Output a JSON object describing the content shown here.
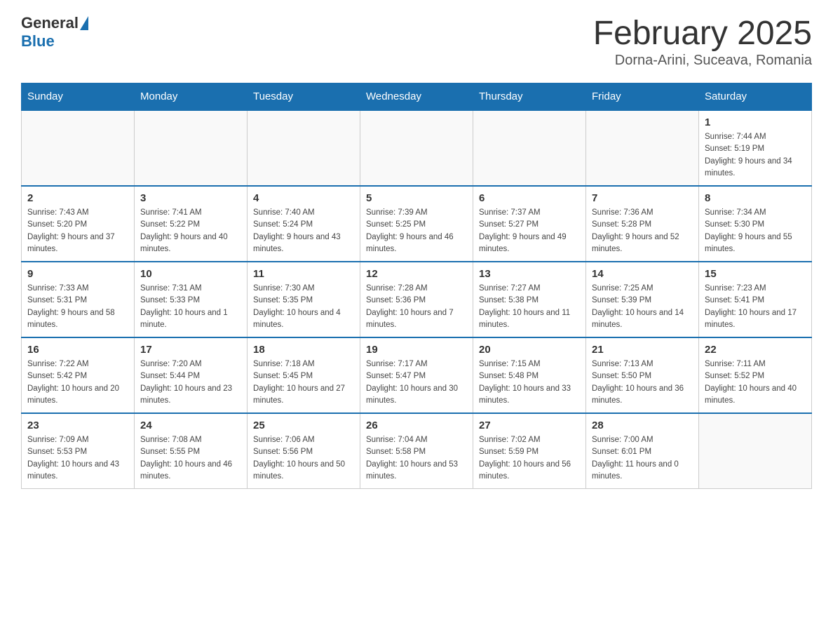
{
  "logo": {
    "general_text": "General",
    "blue_text": "Blue"
  },
  "title": {
    "month_year": "February 2025",
    "location": "Dorna-Arini, Suceava, Romania"
  },
  "weekdays": [
    "Sunday",
    "Monday",
    "Tuesday",
    "Wednesday",
    "Thursday",
    "Friday",
    "Saturday"
  ],
  "weeks": [
    [
      {
        "day": "",
        "info": ""
      },
      {
        "day": "",
        "info": ""
      },
      {
        "day": "",
        "info": ""
      },
      {
        "day": "",
        "info": ""
      },
      {
        "day": "",
        "info": ""
      },
      {
        "day": "",
        "info": ""
      },
      {
        "day": "1",
        "info": "Sunrise: 7:44 AM\nSunset: 5:19 PM\nDaylight: 9 hours and 34 minutes."
      }
    ],
    [
      {
        "day": "2",
        "info": "Sunrise: 7:43 AM\nSunset: 5:20 PM\nDaylight: 9 hours and 37 minutes."
      },
      {
        "day": "3",
        "info": "Sunrise: 7:41 AM\nSunset: 5:22 PM\nDaylight: 9 hours and 40 minutes."
      },
      {
        "day": "4",
        "info": "Sunrise: 7:40 AM\nSunset: 5:24 PM\nDaylight: 9 hours and 43 minutes."
      },
      {
        "day": "5",
        "info": "Sunrise: 7:39 AM\nSunset: 5:25 PM\nDaylight: 9 hours and 46 minutes."
      },
      {
        "day": "6",
        "info": "Sunrise: 7:37 AM\nSunset: 5:27 PM\nDaylight: 9 hours and 49 minutes."
      },
      {
        "day": "7",
        "info": "Sunrise: 7:36 AM\nSunset: 5:28 PM\nDaylight: 9 hours and 52 minutes."
      },
      {
        "day": "8",
        "info": "Sunrise: 7:34 AM\nSunset: 5:30 PM\nDaylight: 9 hours and 55 minutes."
      }
    ],
    [
      {
        "day": "9",
        "info": "Sunrise: 7:33 AM\nSunset: 5:31 PM\nDaylight: 9 hours and 58 minutes."
      },
      {
        "day": "10",
        "info": "Sunrise: 7:31 AM\nSunset: 5:33 PM\nDaylight: 10 hours and 1 minute."
      },
      {
        "day": "11",
        "info": "Sunrise: 7:30 AM\nSunset: 5:35 PM\nDaylight: 10 hours and 4 minutes."
      },
      {
        "day": "12",
        "info": "Sunrise: 7:28 AM\nSunset: 5:36 PM\nDaylight: 10 hours and 7 minutes."
      },
      {
        "day": "13",
        "info": "Sunrise: 7:27 AM\nSunset: 5:38 PM\nDaylight: 10 hours and 11 minutes."
      },
      {
        "day": "14",
        "info": "Sunrise: 7:25 AM\nSunset: 5:39 PM\nDaylight: 10 hours and 14 minutes."
      },
      {
        "day": "15",
        "info": "Sunrise: 7:23 AM\nSunset: 5:41 PM\nDaylight: 10 hours and 17 minutes."
      }
    ],
    [
      {
        "day": "16",
        "info": "Sunrise: 7:22 AM\nSunset: 5:42 PM\nDaylight: 10 hours and 20 minutes."
      },
      {
        "day": "17",
        "info": "Sunrise: 7:20 AM\nSunset: 5:44 PM\nDaylight: 10 hours and 23 minutes."
      },
      {
        "day": "18",
        "info": "Sunrise: 7:18 AM\nSunset: 5:45 PM\nDaylight: 10 hours and 27 minutes."
      },
      {
        "day": "19",
        "info": "Sunrise: 7:17 AM\nSunset: 5:47 PM\nDaylight: 10 hours and 30 minutes."
      },
      {
        "day": "20",
        "info": "Sunrise: 7:15 AM\nSunset: 5:48 PM\nDaylight: 10 hours and 33 minutes."
      },
      {
        "day": "21",
        "info": "Sunrise: 7:13 AM\nSunset: 5:50 PM\nDaylight: 10 hours and 36 minutes."
      },
      {
        "day": "22",
        "info": "Sunrise: 7:11 AM\nSunset: 5:52 PM\nDaylight: 10 hours and 40 minutes."
      }
    ],
    [
      {
        "day": "23",
        "info": "Sunrise: 7:09 AM\nSunset: 5:53 PM\nDaylight: 10 hours and 43 minutes."
      },
      {
        "day": "24",
        "info": "Sunrise: 7:08 AM\nSunset: 5:55 PM\nDaylight: 10 hours and 46 minutes."
      },
      {
        "day": "25",
        "info": "Sunrise: 7:06 AM\nSunset: 5:56 PM\nDaylight: 10 hours and 50 minutes."
      },
      {
        "day": "26",
        "info": "Sunrise: 7:04 AM\nSunset: 5:58 PM\nDaylight: 10 hours and 53 minutes."
      },
      {
        "day": "27",
        "info": "Sunrise: 7:02 AM\nSunset: 5:59 PM\nDaylight: 10 hours and 56 minutes."
      },
      {
        "day": "28",
        "info": "Sunrise: 7:00 AM\nSunset: 6:01 PM\nDaylight: 11 hours and 0 minutes."
      },
      {
        "day": "",
        "info": ""
      }
    ]
  ]
}
